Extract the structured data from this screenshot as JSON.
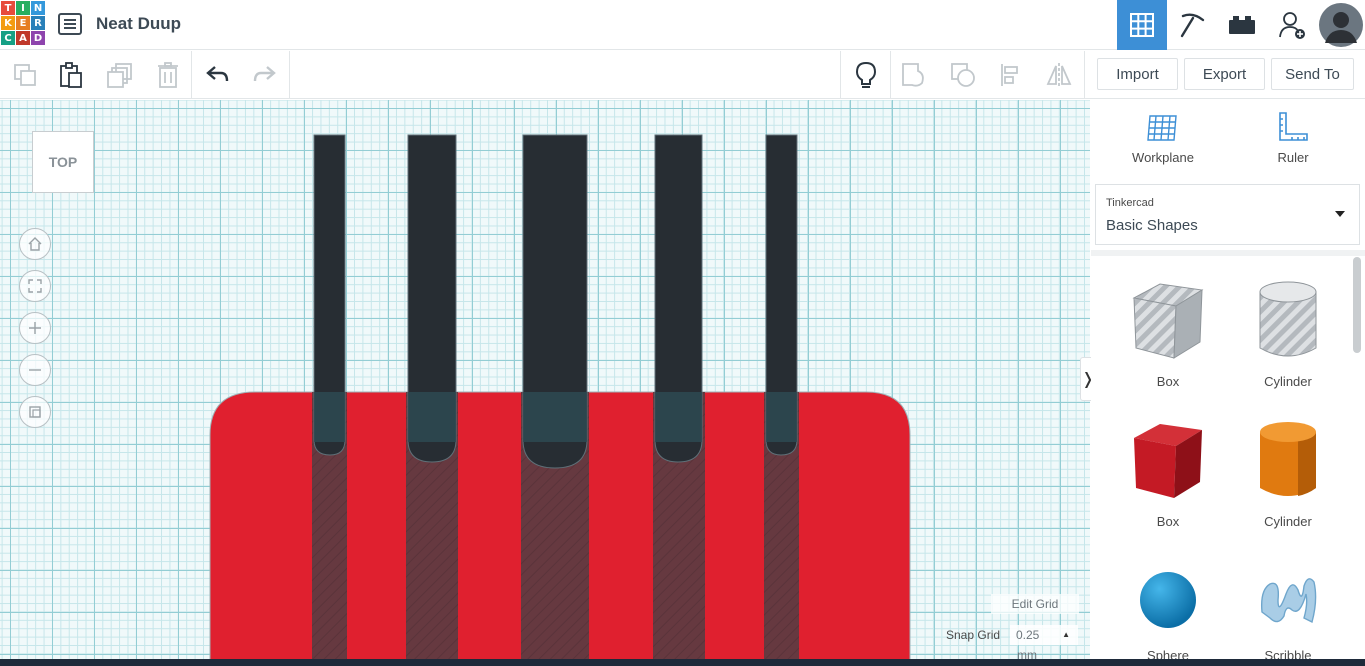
{
  "app": {
    "logo_letters": [
      "T",
      "I",
      "N",
      "K",
      "E",
      "R",
      "C",
      "A",
      "D"
    ],
    "logo_colors": [
      "#e74c3c",
      "#27ae60",
      "#3498db",
      "#f39c12",
      "#e67e22",
      "#2980b9",
      "#16a085",
      "#c0392b",
      "#8e44ad"
    ],
    "design_title": "Neat Duup"
  },
  "header_views": [
    {
      "name": "3d-design-view",
      "icon": "grid-icon",
      "active": true
    },
    {
      "name": "build-view",
      "icon": "pickaxe-icon",
      "active": false
    },
    {
      "name": "bricks-view",
      "icon": "brick-icon",
      "active": false
    },
    {
      "name": "add-user",
      "icon": "add-user-icon",
      "active": false
    },
    {
      "name": "profile",
      "icon": "avatar",
      "active": false
    }
  ],
  "toolbar": {
    "import_label": "Import",
    "export_label": "Export",
    "send_to_label": "Send To"
  },
  "canvas": {
    "view_cube_label": "TOP",
    "edit_grid_label": "Edit Grid",
    "snap_grid_label": "Snap Grid",
    "snap_grid_value": "0.25",
    "snap_grid_unit": "mm"
  },
  "panel": {
    "workplane_label": "Workplane",
    "ruler_label": "Ruler",
    "library_provider": "Tinkercad",
    "library_name": "Basic Shapes",
    "shapes": [
      {
        "label": "Box",
        "kind": "box-hole"
      },
      {
        "label": "Cylinder",
        "kind": "cylinder-hole"
      },
      {
        "label": "Box",
        "kind": "box"
      },
      {
        "label": "Cylinder",
        "kind": "cylinder"
      },
      {
        "label": "Sphere",
        "kind": "sphere"
      },
      {
        "label": "Scribble",
        "kind": "scribble"
      }
    ]
  },
  "colors": {
    "accent": "#3d8fd6",
    "red_shape": "#e0202f",
    "dark_shape": "#272d33",
    "hole_overlap": "#663940"
  }
}
